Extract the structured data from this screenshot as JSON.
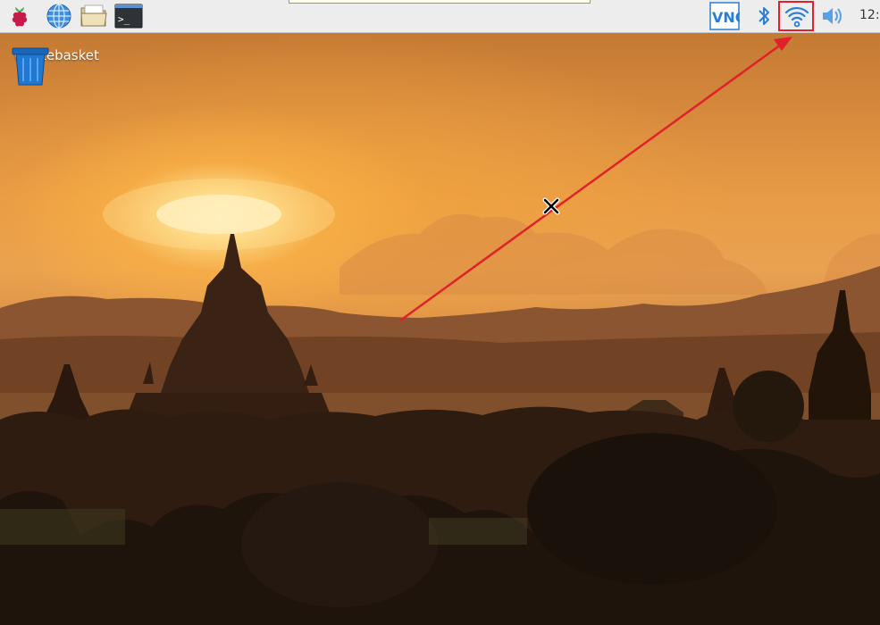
{
  "taskbar": {
    "launchers": [
      {
        "name": "menu-button",
        "icon": "raspberry-icon"
      },
      {
        "name": "web-browser-launcher",
        "icon": "globe-icon"
      },
      {
        "name": "file-manager-launcher",
        "icon": "folder-icon"
      },
      {
        "name": "terminal-launcher",
        "icon": "terminal-icon",
        "glyph": ">_"
      }
    ],
    "tray": {
      "vnc_label": "VNC",
      "icons": [
        "vnc-icon",
        "bluetooth-icon",
        "wifi-icon",
        "volume-icon"
      ],
      "clock": "12:"
    },
    "highlight_target": "wifi-icon"
  },
  "desktop": {
    "wallpaper": "sunset over pagodas",
    "icons": [
      {
        "label": "Wastebasket",
        "icon": "trash-icon"
      }
    ]
  },
  "annotation": {
    "color": "#e0202a"
  },
  "colors": {
    "panel_bg": "#ededed",
    "raspberry": "#c51a4a",
    "tray_blue": "#2a7fd4",
    "trash_blue": "#1f78d1"
  }
}
